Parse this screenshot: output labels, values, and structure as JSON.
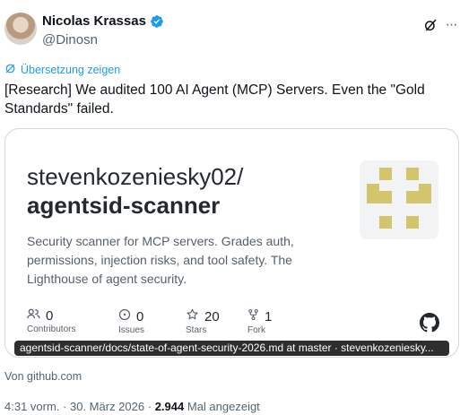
{
  "author": {
    "display_name": "Nicolas Krassas",
    "handle": "@Dinosn"
  },
  "translate_label": "Übersetzung zeigen",
  "tweet_text": "[Research] We audited 100 AI Agent (MCP) Servers. Even the \"Gold Standards\" failed.",
  "card": {
    "repo_owner": "stevenkozeniesky02/",
    "repo_name": "agentsid-scanner",
    "description": "Security scanner for MCP servers. Grades auth, permissions, injection risks, and tool safety. The Lighthouse of agent security.",
    "stats": [
      {
        "value": "0",
        "label": "Contributors",
        "icon": "people-icon"
      },
      {
        "value": "0",
        "label": "Issues",
        "icon": "issue-icon"
      },
      {
        "value": "20",
        "label": "Stars",
        "icon": "star-icon"
      },
      {
        "value": "1",
        "label": "Fork",
        "icon": "fork-icon"
      }
    ],
    "title_overlay": "agentsid-scanner/docs/state-of-agent-security-2026.md at master · stevenkozenieskу..."
  },
  "source": "Von github.com",
  "meta": {
    "time": "4:31 vorm.",
    "date": "30. März 2026",
    "views": "2.944",
    "views_label": "Mal angezeigt"
  },
  "colors": {
    "accent": "#1d9bf0",
    "identicon": "#d4c56c"
  }
}
